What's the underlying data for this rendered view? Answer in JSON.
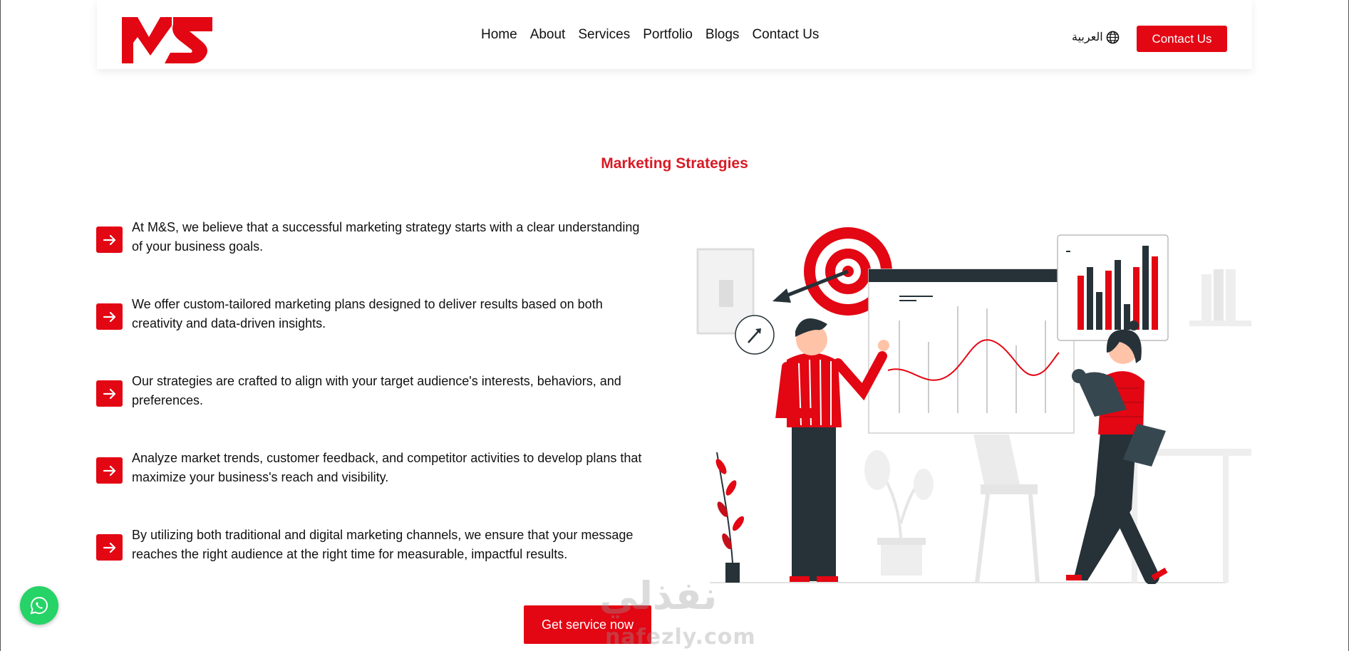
{
  "header": {
    "logo_alt": "M&S",
    "nav": [
      "Home",
      "About",
      "Services",
      "Portfolio",
      "Blogs",
      "Contact Us"
    ],
    "language_label": "العربية",
    "contact_button": "Contact Us"
  },
  "main": {
    "title": "Marketing Strategies",
    "points": [
      "At M&S, we believe that a successful marketing strategy starts with a clear understanding of your business goals.",
      "We offer custom-tailored marketing plans designed to deliver results based on both creativity and data-driven insights.",
      "Our strategies are crafted to align with your target audience's interests, behaviors, and preferences.",
      "Analyze market trends, customer feedback, and competitor activities to develop plans that maximize your business's reach and visibility.",
      "By utilizing both traditional and digital marketing channels, we ensure that your message reaches the right audience at the right time for measurable, impactful results."
    ],
    "cta_button": "Get service now"
  },
  "watermark": {
    "arabic": "نفذلي",
    "latin": "nafezly.com"
  },
  "colors": {
    "brand_red": "#e30613",
    "title_red": "#d81a25",
    "whatsapp_green": "#25d366"
  },
  "icons": [
    "logo",
    "globe-icon",
    "arrow-right-icon",
    "whatsapp-icon"
  ]
}
